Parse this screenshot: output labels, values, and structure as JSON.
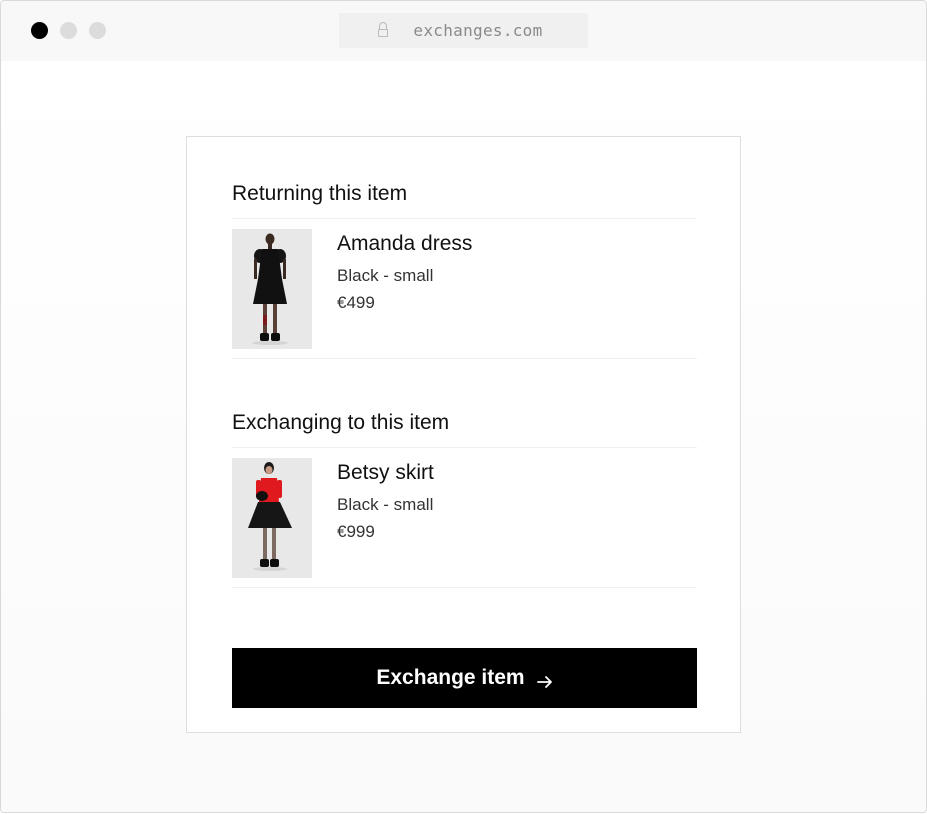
{
  "browser": {
    "url": "exchanges.com"
  },
  "returning": {
    "heading": "Returning this item",
    "item": {
      "name": "Amanda dress",
      "variant": "Black - small",
      "price": "€499",
      "image_icon": "dress-photo"
    }
  },
  "exchanging": {
    "heading": "Exchanging to this item",
    "item": {
      "name": "Betsy skirt",
      "variant": "Black - small",
      "price": "€999",
      "image_icon": "skirt-photo"
    }
  },
  "action": {
    "label": "Exchange item",
    "icon": "arrow-right-icon"
  },
  "colors": {
    "button_bg": "#000000",
    "button_text": "#ffffff",
    "accent_red": "#e0191f"
  }
}
